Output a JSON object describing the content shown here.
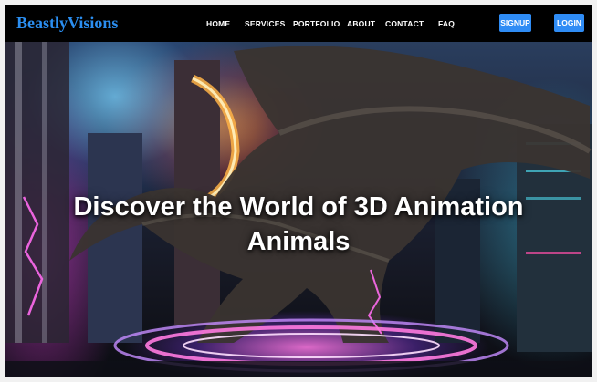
{
  "brand": {
    "name": "BeastlyVisions"
  },
  "nav": {
    "links": [
      "HOME",
      "SERVICES",
      "PORTFOLIO",
      "ABOUT",
      "CONTACT",
      "FAQ"
    ],
    "signup_label": "SIGNUP",
    "login_label": "LOGIN"
  },
  "hero": {
    "title_line1": "Discover the World of 3D Animation",
    "title_line2": "Animals"
  },
  "colors": {
    "brand": "#2b8ef0",
    "button": "#2f8cf5",
    "navbar": "#000000",
    "title": "#ffffff"
  }
}
